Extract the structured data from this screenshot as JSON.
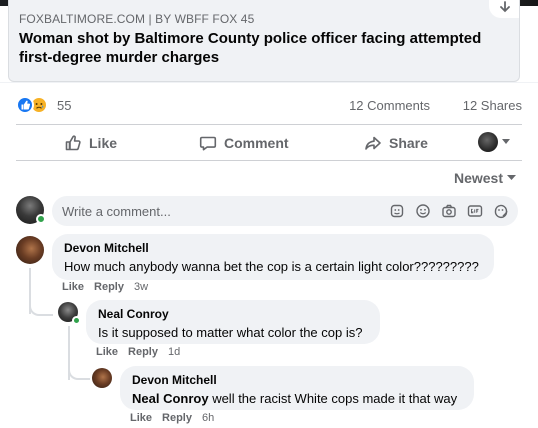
{
  "link_preview": {
    "source": "FOXBALTIMORE.COM | BY WBFF FOX 45",
    "title": "Woman shot by Baltimore County police officer facing attempted first-degree murder charges"
  },
  "stats": {
    "reaction_count": "55",
    "comments": "12 Comments",
    "shares": "12 Shares"
  },
  "actions": {
    "like": "Like",
    "comment": "Comment",
    "share": "Share"
  },
  "sort": {
    "label": "Newest"
  },
  "composer": {
    "placeholder": "Write a comment..."
  },
  "comments": [
    {
      "author": "Devon Mitchell",
      "text": "How much anybody wanna bet the cop is a certain light color?????????",
      "like": "Like",
      "reply": "Reply",
      "time": "3w"
    },
    {
      "author": "Neal Conroy",
      "text": "Is it supposed to matter what color the cop is?",
      "like": "Like",
      "reply": "Reply",
      "time": "1d"
    },
    {
      "author": "Devon Mitchell",
      "tag": "Neal Conroy",
      "text": " well the racist White cops made it that way",
      "like": "Like",
      "reply": "Reply",
      "time": "6h"
    }
  ],
  "colors": {
    "accent_blue": "#1877f2",
    "muted_text": "#65676b",
    "bubble_bg": "#f0f2f5",
    "online_green": "#31a24c"
  },
  "icons": [
    "like-reaction-icon",
    "sad-reaction-icon",
    "thumbs-up-icon",
    "comment-icon",
    "share-icon",
    "caret-down-icon",
    "sticker-icon",
    "emoji-icon",
    "camera-icon",
    "gif-icon",
    "avatar-sticker-icon"
  ]
}
